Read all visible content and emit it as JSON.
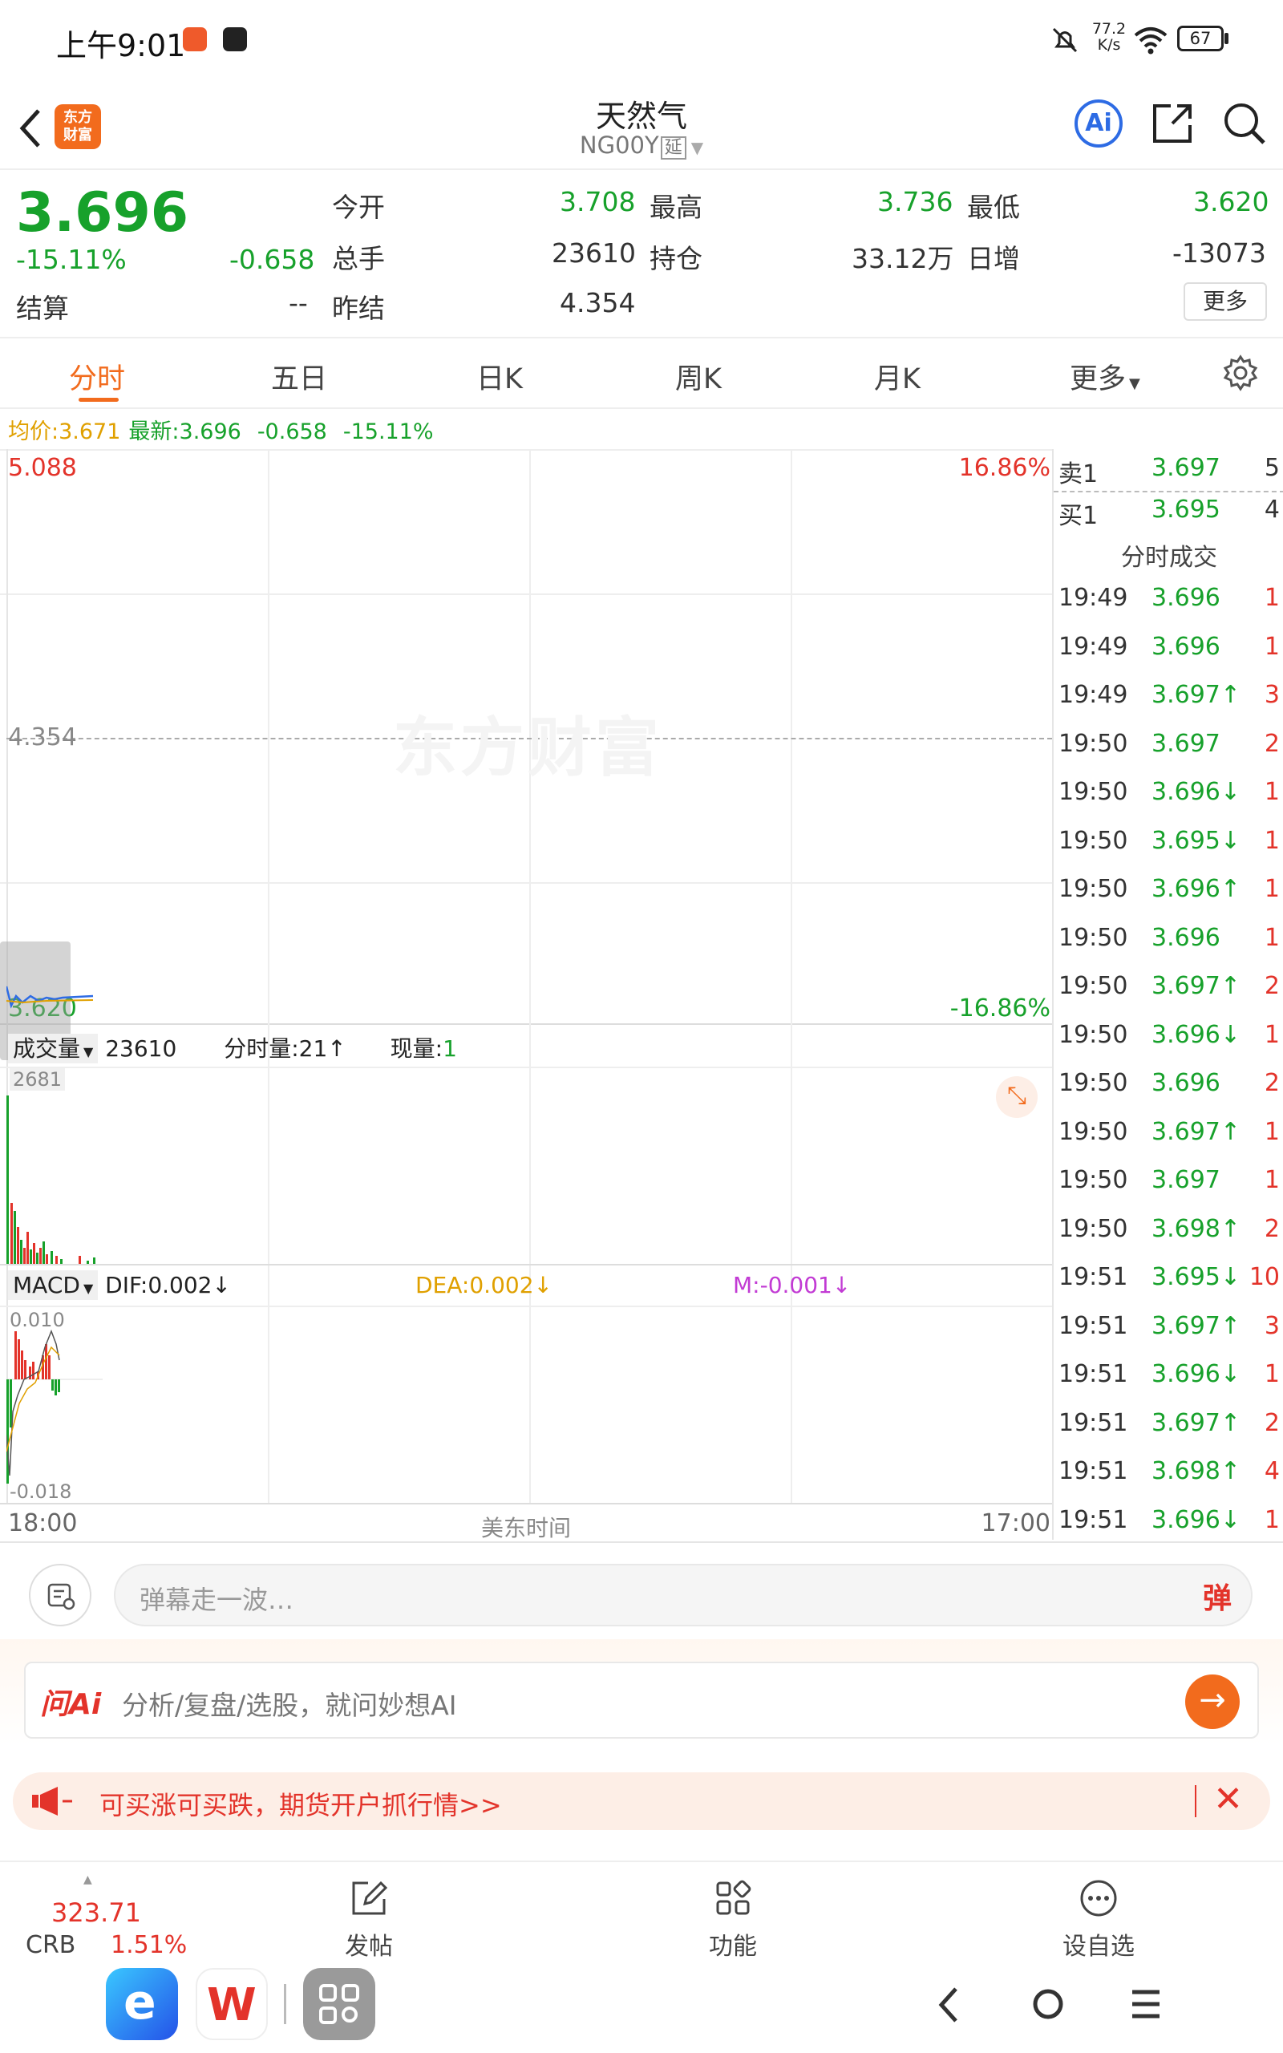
{
  "status": {
    "time": "上午9:01",
    "speed_top": "77.2",
    "speed_bottom": "K/s",
    "battery": "67"
  },
  "header": {
    "title": "天然气",
    "code": "NG00Y",
    "delay_badge": "延",
    "logo_line1": "东方",
    "logo_line2": "财富",
    "ai_label": "Ai"
  },
  "quote": {
    "price": "3.696",
    "change_pct": "-15.11%",
    "change": "-0.658",
    "open_label": "今开",
    "open": "3.708",
    "high_label": "最高",
    "high": "3.736",
    "low_label": "最低",
    "low": "3.620",
    "vol_label": "总手",
    "vol": "23610",
    "oi_label": "持仓",
    "oi": "33.12万",
    "daily_inc_label": "日增",
    "daily_inc": "-13073",
    "settle_label": "结算",
    "settle": "--",
    "prev_settle_label": "昨结",
    "prev_settle": "4.354",
    "more": "更多"
  },
  "tabs": {
    "items": [
      "分时",
      "五日",
      "日K",
      "周K",
      "月K",
      "更多"
    ],
    "active": 0
  },
  "info_line": {
    "avg_label": "均价:",
    "avg": "3.671",
    "latest_label": "最新:",
    "latest": "3.696",
    "chg": "-0.658",
    "pct": "-15.11%"
  },
  "chart": {
    "y_top": "5.088",
    "pct_top": "16.86%",
    "y_mid": "4.354",
    "y_bottom": "3.620",
    "pct_bottom": "-16.86%",
    "watermark": "东方财富",
    "vol_label": "成交量",
    "vol_value": "23610",
    "vol_tick_label": "分时量:21↑",
    "cur_vol_label": "现量:",
    "cur_vol": "1",
    "vol_max": "2681",
    "macd_label": "MACD",
    "dif": "DIF:0.002↓",
    "dea": "DEA:0.002↓",
    "m": "M:-0.001↓",
    "macd_top": "0.010",
    "macd_bottom": "-0.018",
    "x_start": "18:00",
    "x_mid": "美东时间",
    "x_end": "17:00"
  },
  "orderbook": {
    "ask_label": "卖1",
    "ask_price": "3.697",
    "ask_vol": "5",
    "bid_label": "买1",
    "bid_price": "3.695",
    "bid_vol": "4",
    "ticks_title": "分时成交"
  },
  "ticks": [
    {
      "t": "19:49",
      "p": "3.696",
      "v": "1"
    },
    {
      "t": "19:49",
      "p": "3.696",
      "v": "1"
    },
    {
      "t": "19:49",
      "p": "3.697↑",
      "v": "3"
    },
    {
      "t": "19:50",
      "p": "3.697",
      "v": "2"
    },
    {
      "t": "19:50",
      "p": "3.696↓",
      "v": "1"
    },
    {
      "t": "19:50",
      "p": "3.695↓",
      "v": "1"
    },
    {
      "t": "19:50",
      "p": "3.696↑",
      "v": "1"
    },
    {
      "t": "19:50",
      "p": "3.696",
      "v": "1"
    },
    {
      "t": "19:50",
      "p": "3.697↑",
      "v": "2"
    },
    {
      "t": "19:50",
      "p": "3.696↓",
      "v": "1"
    },
    {
      "t": "19:50",
      "p": "3.696",
      "v": "2"
    },
    {
      "t": "19:50",
      "p": "3.697↑",
      "v": "1"
    },
    {
      "t": "19:50",
      "p": "3.697",
      "v": "1"
    },
    {
      "t": "19:50",
      "p": "3.698↑",
      "v": "2"
    },
    {
      "t": "19:51",
      "p": "3.695↓",
      "v": "10"
    },
    {
      "t": "19:51",
      "p": "3.697↑",
      "v": "3"
    },
    {
      "t": "19:51",
      "p": "3.696↓",
      "v": "1"
    },
    {
      "t": "19:51",
      "p": "3.697↑",
      "v": "2"
    },
    {
      "t": "19:51",
      "p": "3.698↑",
      "v": "4"
    },
    {
      "t": "19:51",
      "p": "3.696↓",
      "v": "1"
    }
  ],
  "comment": {
    "placeholder": "弹幕走一波…",
    "send": "弹"
  },
  "ai_box": {
    "logo": "问Ai",
    "placeholder": "分析/复盘/选股，就问妙想AI"
  },
  "banner": {
    "text": "可买涨可买跌，期货开户抓行情>>"
  },
  "bottom": {
    "crb_value": "323.71",
    "crb_label": "CRB",
    "crb_pct": "1.51%",
    "post": "发帖",
    "func": "功能",
    "watch": "设自选"
  }
}
